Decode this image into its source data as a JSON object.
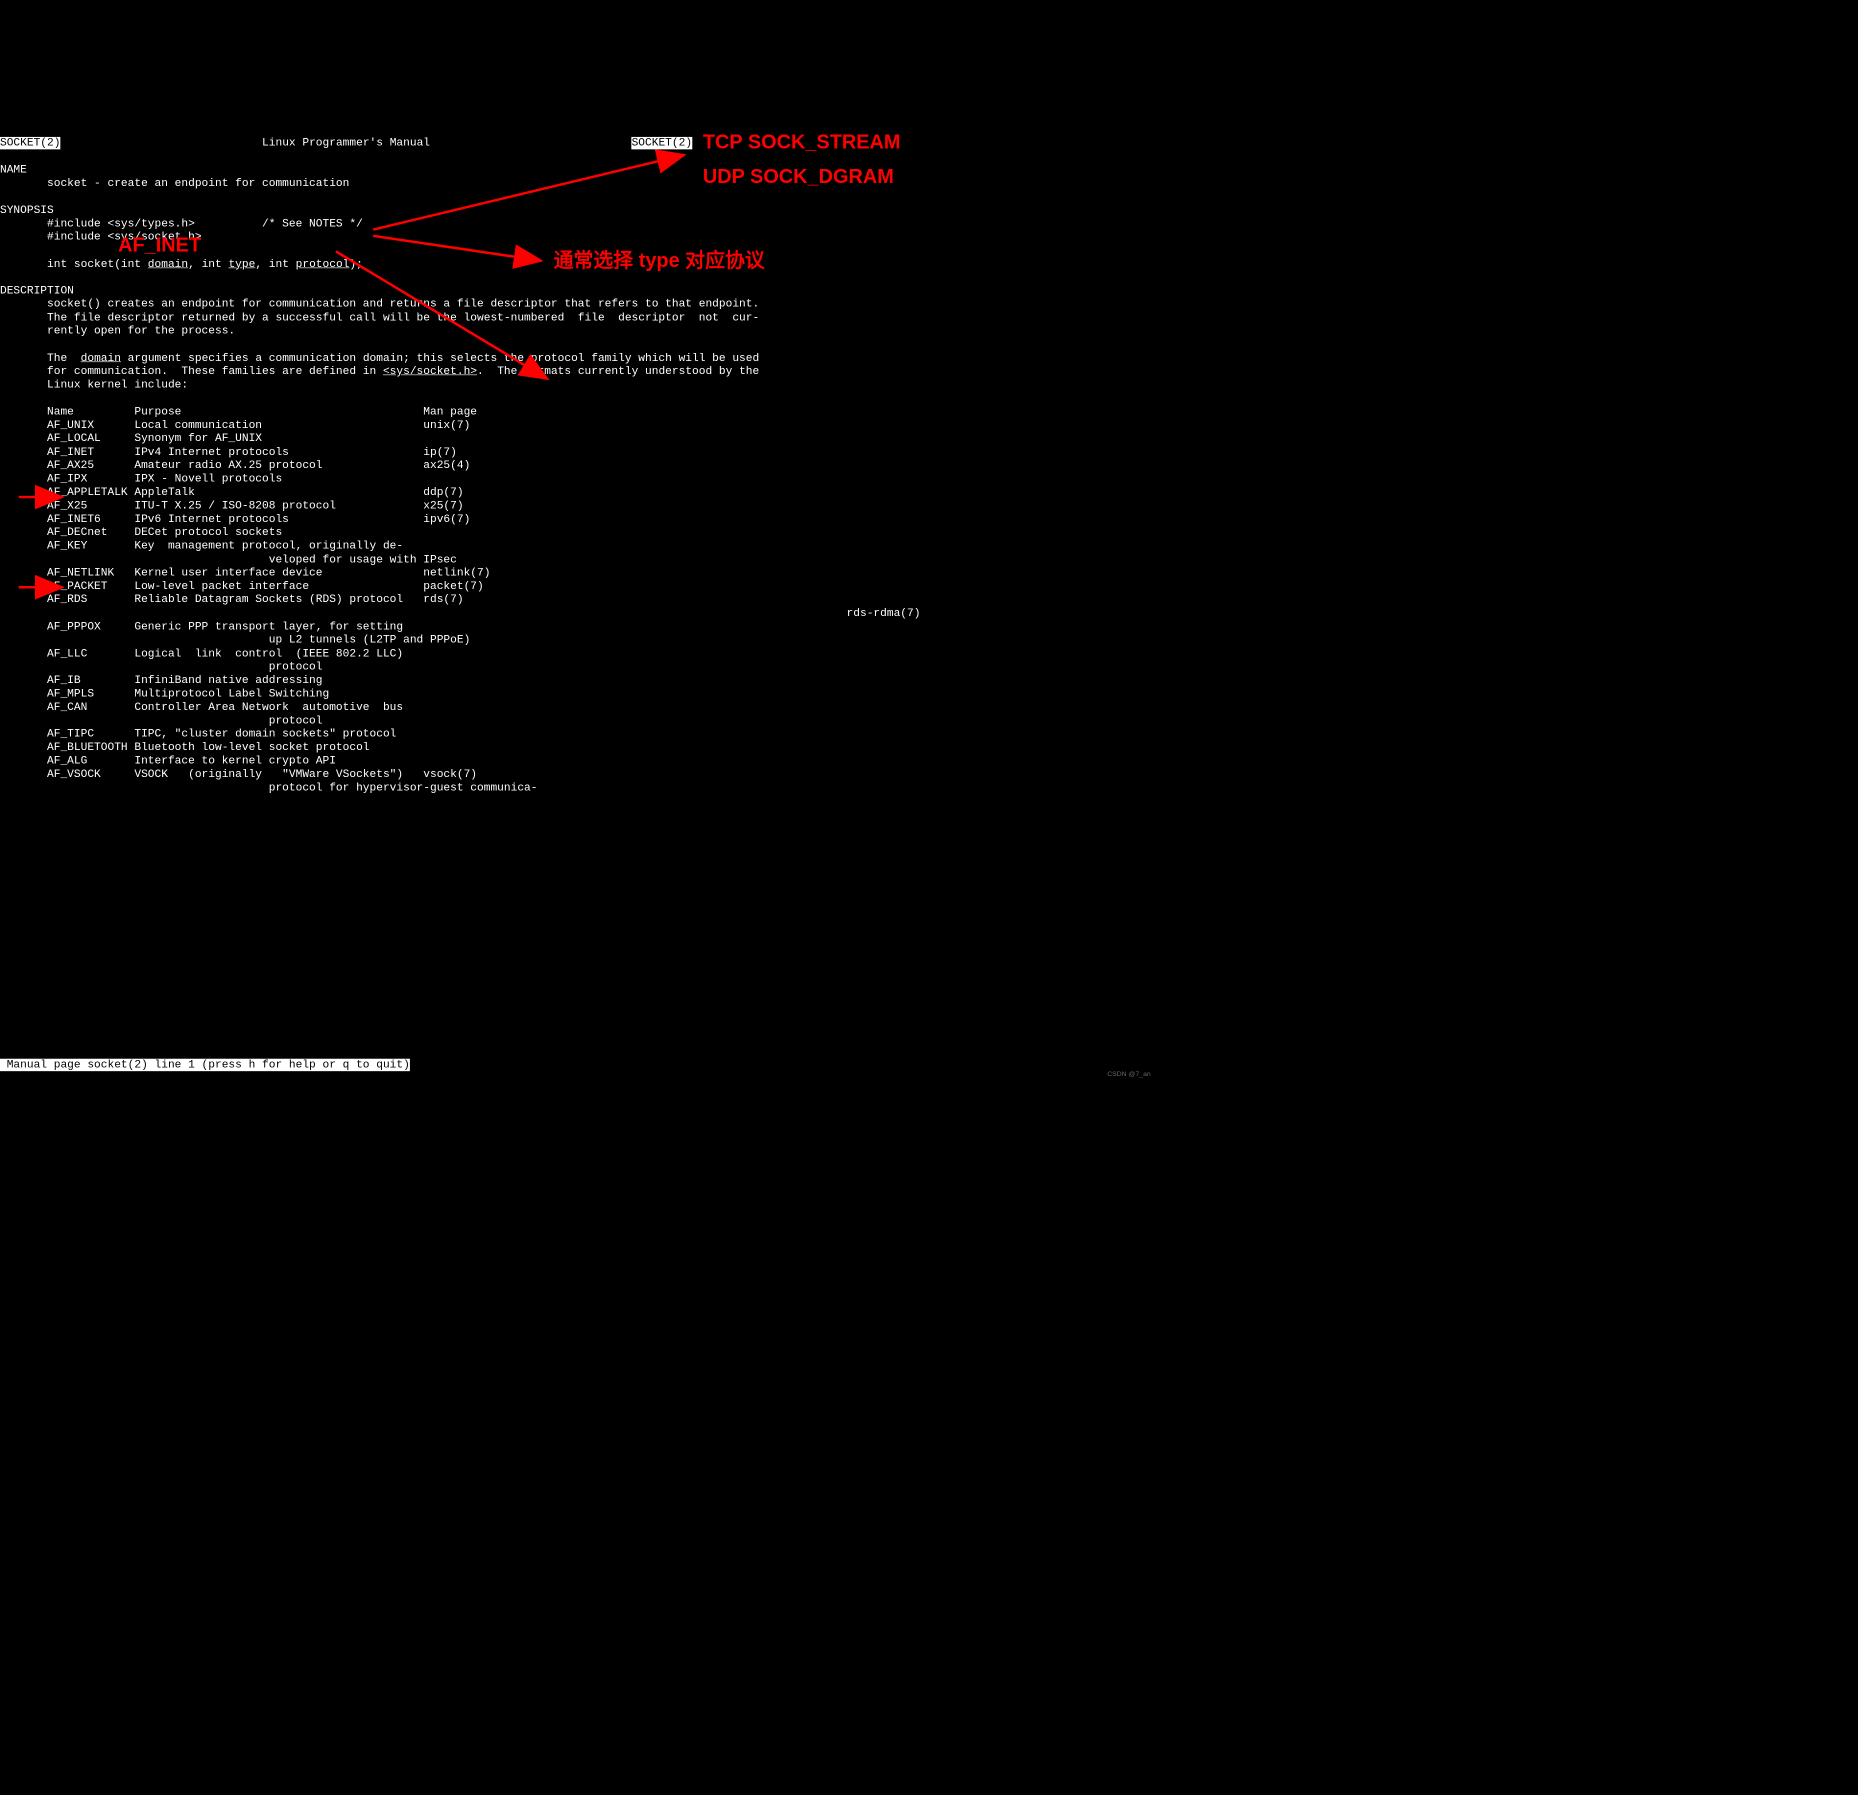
{
  "header": {
    "left": "SOCKET(2)",
    "center": "Linux Programmer's Manual",
    "right": "SOCKET(2)"
  },
  "sec": {
    "name_h": "NAME",
    "name": "       socket - create an endpoint for communication",
    "syn_h": "SYNOPSIS",
    "inc1": "       #include <sys/types.h>          /* See NOTES */",
    "inc2": "       #include <sys/socket.h>",
    "sig_pre": "       int socket(int ",
    "sig_domain": "domain",
    "sig_mid1": ", int ",
    "sig_type": "type",
    "sig_mid2": ", int ",
    "sig_proto": "protocol",
    "sig_post": ");",
    "desc_h": "DESCRIPTION",
    "desc_p1": "       socket() creates an endpoint for communication and returns a file descriptor that refers to that endpoint.\n       The file descriptor returned by a successful call will be the lowest-numbered  file  descriptor  not  cur‐\n       rently open for the process.",
    "desc_p2a": "       The  ",
    "desc_domain": "domain",
    "desc_p2b": " argument specifies a communication domain; this selects the protocol family which will be used\n       for communication.  These families are defined in ",
    "desc_inc": "<sys/socket.h>",
    "desc_p2c": ".  The formats currently understood by the\n       Linux kernel include:",
    "tbl_h": "       Name         Purpose                                    Man page"
  },
  "rows": [
    {
      "n": "AF_UNIX",
      "p": "Local communication",
      "m": "unix(7)"
    },
    {
      "n": "AF_LOCAL",
      "p": "Synonym for AF_UNIX",
      "m": ""
    },
    {
      "n": "AF_INET",
      "p": "IPv4 Internet protocols",
      "m": "ip(7)"
    },
    {
      "n": "AF_AX25",
      "p": "Amateur radio AX.25 protocol",
      "m": "ax25(4)"
    },
    {
      "n": "AF_IPX",
      "p": "IPX - Novell protocols",
      "m": ""
    },
    {
      "n": "AF_APPLETALK",
      "p": "AppleTalk",
      "m": "ddp(7)"
    },
    {
      "n": "AF_X25",
      "p": "ITU-T X.25 / ISO-8208 protocol",
      "m": "x25(7)"
    },
    {
      "n": "AF_INET6",
      "p": "IPv6 Internet protocols",
      "m": "ipv6(7)"
    },
    {
      "n": "AF_DECnet",
      "p": "DECet protocol sockets",
      "m": ""
    },
    {
      "n": "AF_KEY",
      "p": "Key  management protocol, originally de‐\n                    veloped for usage with IPsec",
      "m": ""
    },
    {
      "n": "AF_NETLINK",
      "p": "Kernel user interface device",
      "m": "netlink(7)"
    },
    {
      "n": "AF_PACKET",
      "p": "Low-level packet interface",
      "m": "packet(7)"
    },
    {
      "n": "AF_RDS",
      "p": "Reliable Datagram Sockets (RDS) protocol",
      "m": "rds(7)\n                                                               rds-rdma(7)"
    },
    {
      "n": "AF_PPPOX",
      "p": "Generic PPP transport layer, for setting\n                    up L2 tunnels (L2TP and PPPoE)",
      "m": ""
    },
    {
      "n": "AF_LLC",
      "p": "Logical  link  control  (IEEE 802.2 LLC)\n                    protocol",
      "m": ""
    },
    {
      "n": "AF_IB",
      "p": "InfiniBand native addressing",
      "m": ""
    },
    {
      "n": "AF_MPLS",
      "p": "Multiprotocol Label Switching",
      "m": ""
    },
    {
      "n": "AF_CAN",
      "p": "Controller Area Network  automotive  bus\n                    protocol",
      "m": ""
    },
    {
      "n": "AF_TIPC",
      "p": "TIPC, \"cluster domain sockets\" protocol",
      "m": ""
    },
    {
      "n": "AF_BLUETOOTH",
      "p": "Bluetooth low-level socket protocol",
      "m": ""
    },
    {
      "n": "AF_ALG",
      "p": "Interface to kernel crypto API",
      "m": ""
    },
    {
      "n": "AF_VSOCK",
      "p": "VSOCK   (originally   \"VMWare VSockets\")\n                    protocol for hypervisor-guest communica‐",
      "m": "vsock(7)"
    }
  ],
  "status": " Manual page socket(2) line 1 (press h for help or q to quit)",
  "watermark": "CSDN @7_an",
  "anno": {
    "af": "AF_INET",
    "tcp": "TCP  SOCK_STREAM",
    "udp": "UDP SOCK_DGRAM",
    "proto": "通常选择  type 对应协议"
  }
}
